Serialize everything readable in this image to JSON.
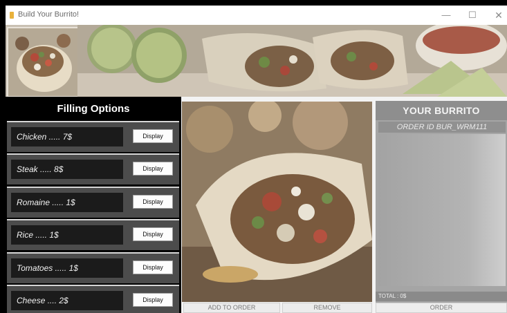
{
  "window": {
    "title": "Build Your Burrito!",
    "controls": {
      "minimize": "—",
      "maximize": "☐",
      "close": "✕"
    }
  },
  "filling_panel": {
    "heading": "Filling Options",
    "display_label": "Display",
    "options": [
      {
        "label": "Chicken ..... 7$"
      },
      {
        "label": "Steak ..... 8$"
      },
      {
        "label": "Romaine ..... 1$"
      },
      {
        "label": "Rice ..... 1$"
      },
      {
        "label": "Tomatoes ..... 1$"
      },
      {
        "label": "Cheese .... 2$"
      }
    ]
  },
  "center": {
    "add_label": "ADD TO ORDER",
    "remove_label": "REMOVE"
  },
  "order_panel": {
    "title": "YOUR BURRITO",
    "order_id": "ORDER ID  BUR_WRM111",
    "total": "TOTAL : 0$",
    "order_label": "ORDER"
  }
}
